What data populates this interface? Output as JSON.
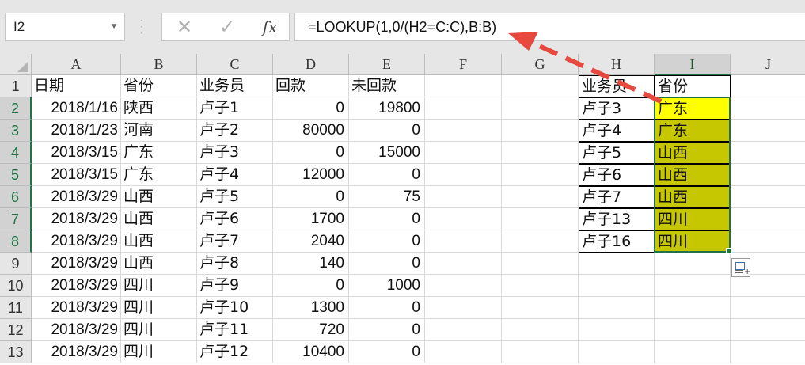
{
  "name_box": {
    "value": "I2"
  },
  "formula_bar": {
    "cancel_icon": "x-icon",
    "enter_icon": "check-icon",
    "fx_label": "fx",
    "formula": "=LOOKUP(1,0/(H2=C:C),B:B)"
  },
  "columns": [
    "A",
    "B",
    "C",
    "D",
    "E",
    "F",
    "G",
    "H",
    "I",
    "J"
  ],
  "rows": [
    "1",
    "2",
    "3",
    "4",
    "5",
    "6",
    "7",
    "8",
    "9",
    "10",
    "11",
    "12",
    "13"
  ],
  "table": {
    "header": [
      "日期",
      "省份",
      "业务员",
      "回款",
      "未回款"
    ],
    "rows": [
      [
        "2018/1/16",
        "陕西",
        "卢子1",
        "0",
        "19800"
      ],
      [
        "2018/1/23",
        "河南",
        "卢子2",
        "80000",
        "0"
      ],
      [
        "2018/3/15",
        "广东",
        "卢子3",
        "0",
        "15000"
      ],
      [
        "2018/3/15",
        "广东",
        "卢子4",
        "12000",
        "0"
      ],
      [
        "2018/3/29",
        "山西",
        "卢子5",
        "0",
        "75"
      ],
      [
        "2018/3/29",
        "山西",
        "卢子6",
        "1700",
        "0"
      ],
      [
        "2018/3/29",
        "山西",
        "卢子7",
        "2040",
        "0"
      ],
      [
        "2018/3/29",
        "山西",
        "卢子8",
        "140",
        "0"
      ],
      [
        "2018/3/29",
        "四川",
        "卢子9",
        "0",
        "1000"
      ],
      [
        "2018/3/29",
        "四川",
        "卢子10",
        "1300",
        "0"
      ],
      [
        "2018/3/29",
        "四川",
        "卢子11",
        "720",
        "0"
      ],
      [
        "2018/3/29",
        "四川",
        "卢子12",
        "10400",
        "0"
      ]
    ]
  },
  "lookup": {
    "header": [
      "业务员",
      "省份"
    ],
    "rows": [
      [
        "卢子3",
        "广东"
      ],
      [
        "卢子4",
        "广东"
      ],
      [
        "卢子5",
        "山西"
      ],
      [
        "卢子6",
        "山西"
      ],
      [
        "卢子7",
        "山西"
      ],
      [
        "卢子13",
        "四川"
      ],
      [
        "卢子16",
        "四川"
      ]
    ]
  },
  "colors": {
    "selection": "#217346",
    "active_fill": "#ffff00",
    "range_fill": "#c7c700",
    "arrow": "#e8493f"
  }
}
